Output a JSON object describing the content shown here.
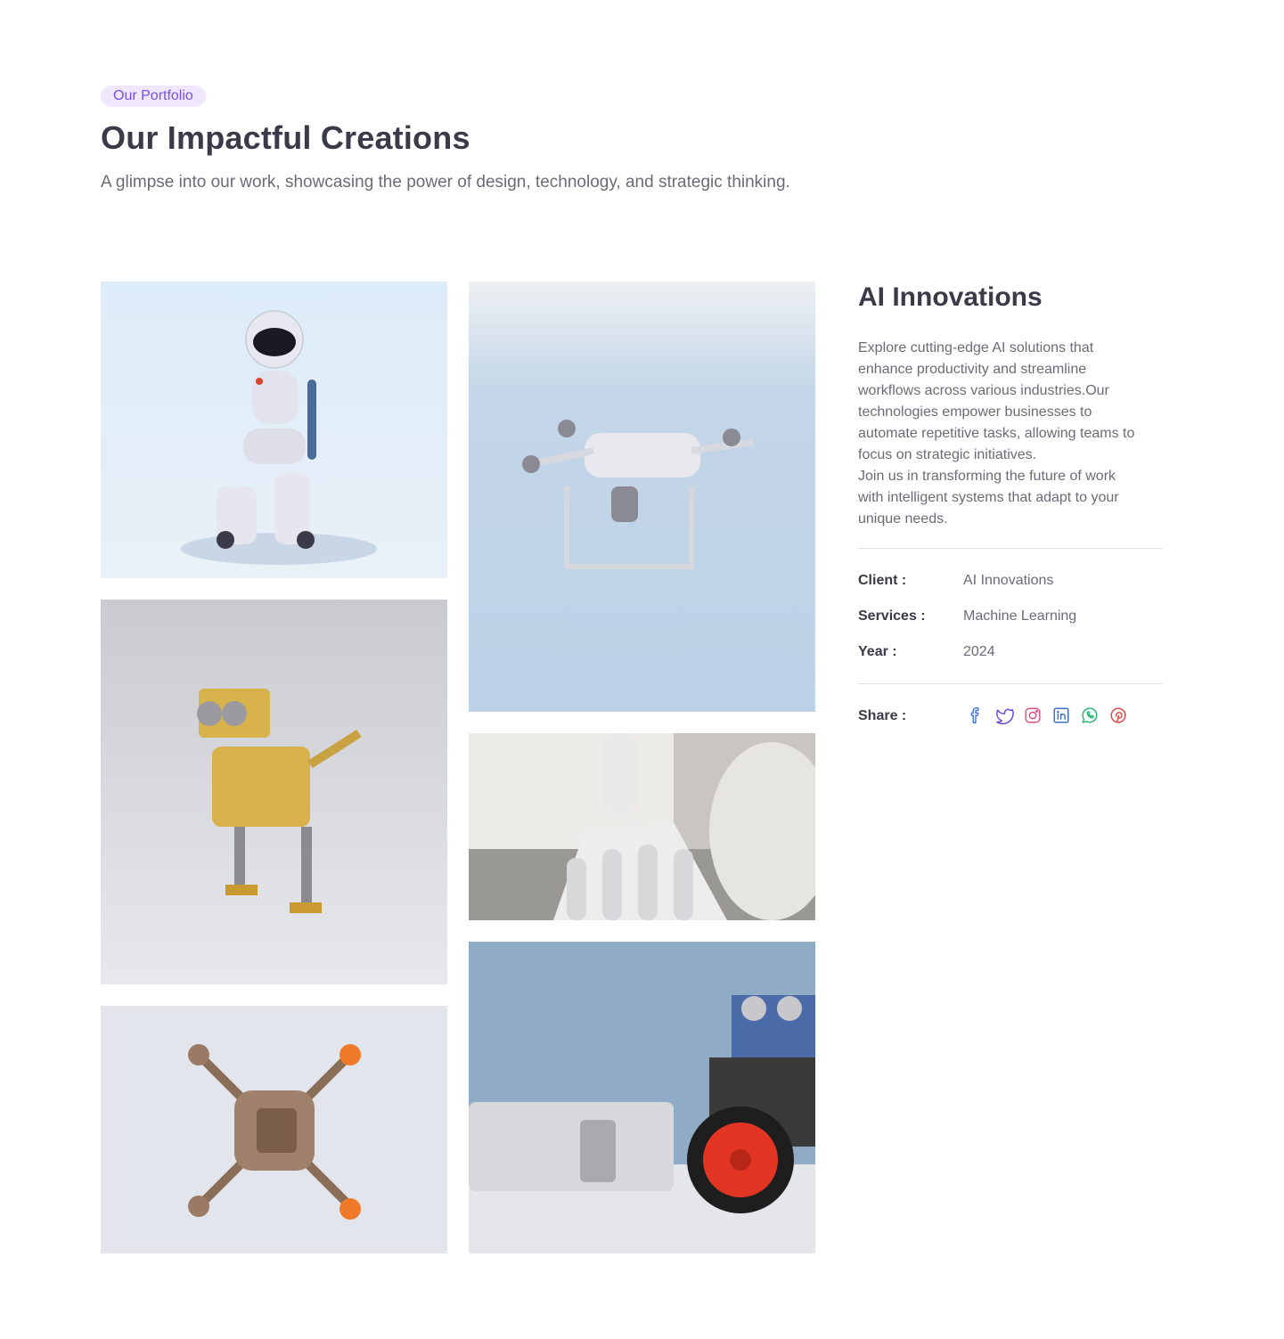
{
  "header": {
    "badge": "Our Portfolio",
    "title": "Our Impactful Creations",
    "subtitle": "A glimpse into our work, showcasing the power of design, technology, and strategic thinking."
  },
  "gallery": [
    {
      "subject": "white-robot-figure"
    },
    {
      "subject": "yellow-robot-dog"
    },
    {
      "subject": "drone-top-view"
    },
    {
      "subject": "white-drone-in-sky"
    },
    {
      "subject": "robotic-hand"
    },
    {
      "subject": "robot-car-kit"
    }
  ],
  "project": {
    "title": "AI Innovations",
    "description": "Explore cutting-edge AI solutions that\nenhance productivity and streamline\nworkflows across various industries.Our\ntechnologies empower businesses to\nautomate repetitive tasks, allowing teams to\nfocus on strategic initiatives.\nJoin us in transforming the future of work\nwith intelligent systems that adapt to your\nunique needs.",
    "client_label": "Client :",
    "client_value": "AI Innovations",
    "services_label": "Services :",
    "services_value": "Machine Learning",
    "year_label": "Year :",
    "year_value": "2024",
    "share_label": "Share :"
  },
  "share_icons": [
    {
      "name": "facebook-icon",
      "color": "#4a7bd9"
    },
    {
      "name": "twitter-icon",
      "color": "#6b4fd8"
    },
    {
      "name": "instagram-icon",
      "color": "#e0507f"
    },
    {
      "name": "linkedin-icon",
      "color": "#3b6fc4"
    },
    {
      "name": "whatsapp-icon",
      "color": "#2bb673"
    },
    {
      "name": "pinterest-icon",
      "color": "#e04848"
    }
  ]
}
